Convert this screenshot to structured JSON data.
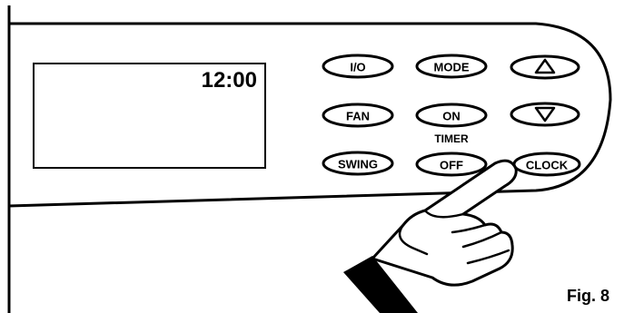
{
  "display": {
    "time": "12:00"
  },
  "buttons": {
    "power": "I/O",
    "mode": "MODE",
    "fan": "FAN",
    "timer_on": "ON",
    "swing": "SWING",
    "timer_off": "OFF",
    "clock": "CLOCK"
  },
  "icons": {
    "up": "triangle-up-icon",
    "down": "triangle-down-icon"
  },
  "timer_label": "TIMER",
  "figure_label": "Fig. 8"
}
